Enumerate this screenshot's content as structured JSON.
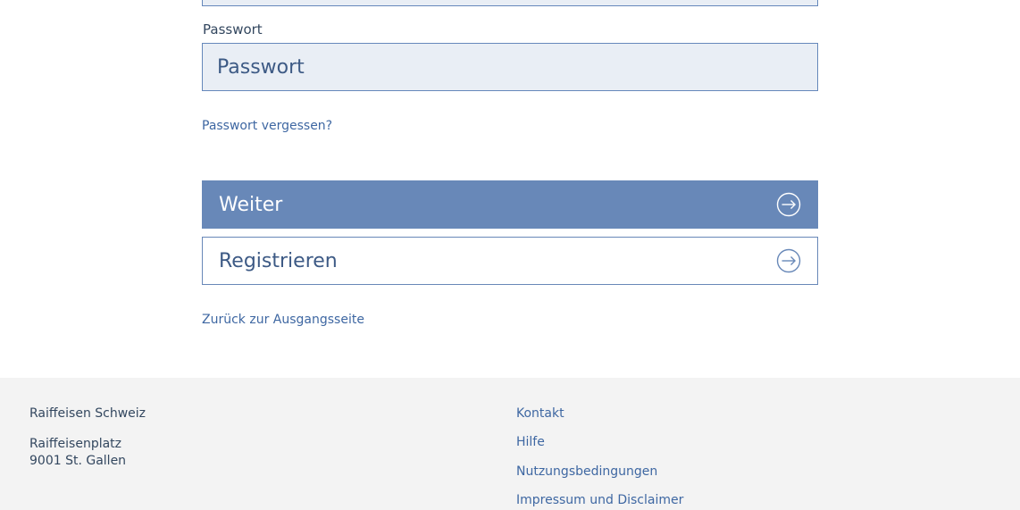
{
  "form": {
    "password_label": "Passwort",
    "password_placeholder": "Passwort",
    "forgot_link": "Passwort vergessen?",
    "next_button": "Weiter",
    "register_button": "Registrieren",
    "back_link": "Zurück zur Ausgangsseite"
  },
  "footer": {
    "org_name": "Raiffeisen Schweiz",
    "address_line1": "Raiffeisenplatz",
    "address_line2": "9001 St. Gallen",
    "links": [
      "Kontakt",
      "Hilfe",
      "Nutzungsbedingungen",
      "Impressum und Disclaimer"
    ]
  },
  "icons": {
    "next": "arrow-right-circle-icon",
    "register": "arrow-right-circle-icon"
  },
  "colors": {
    "primary": "#6888b8",
    "link": "#3e67a2",
    "input_bg": "#e9eef5",
    "footer_bg": "#f3f3f3"
  }
}
